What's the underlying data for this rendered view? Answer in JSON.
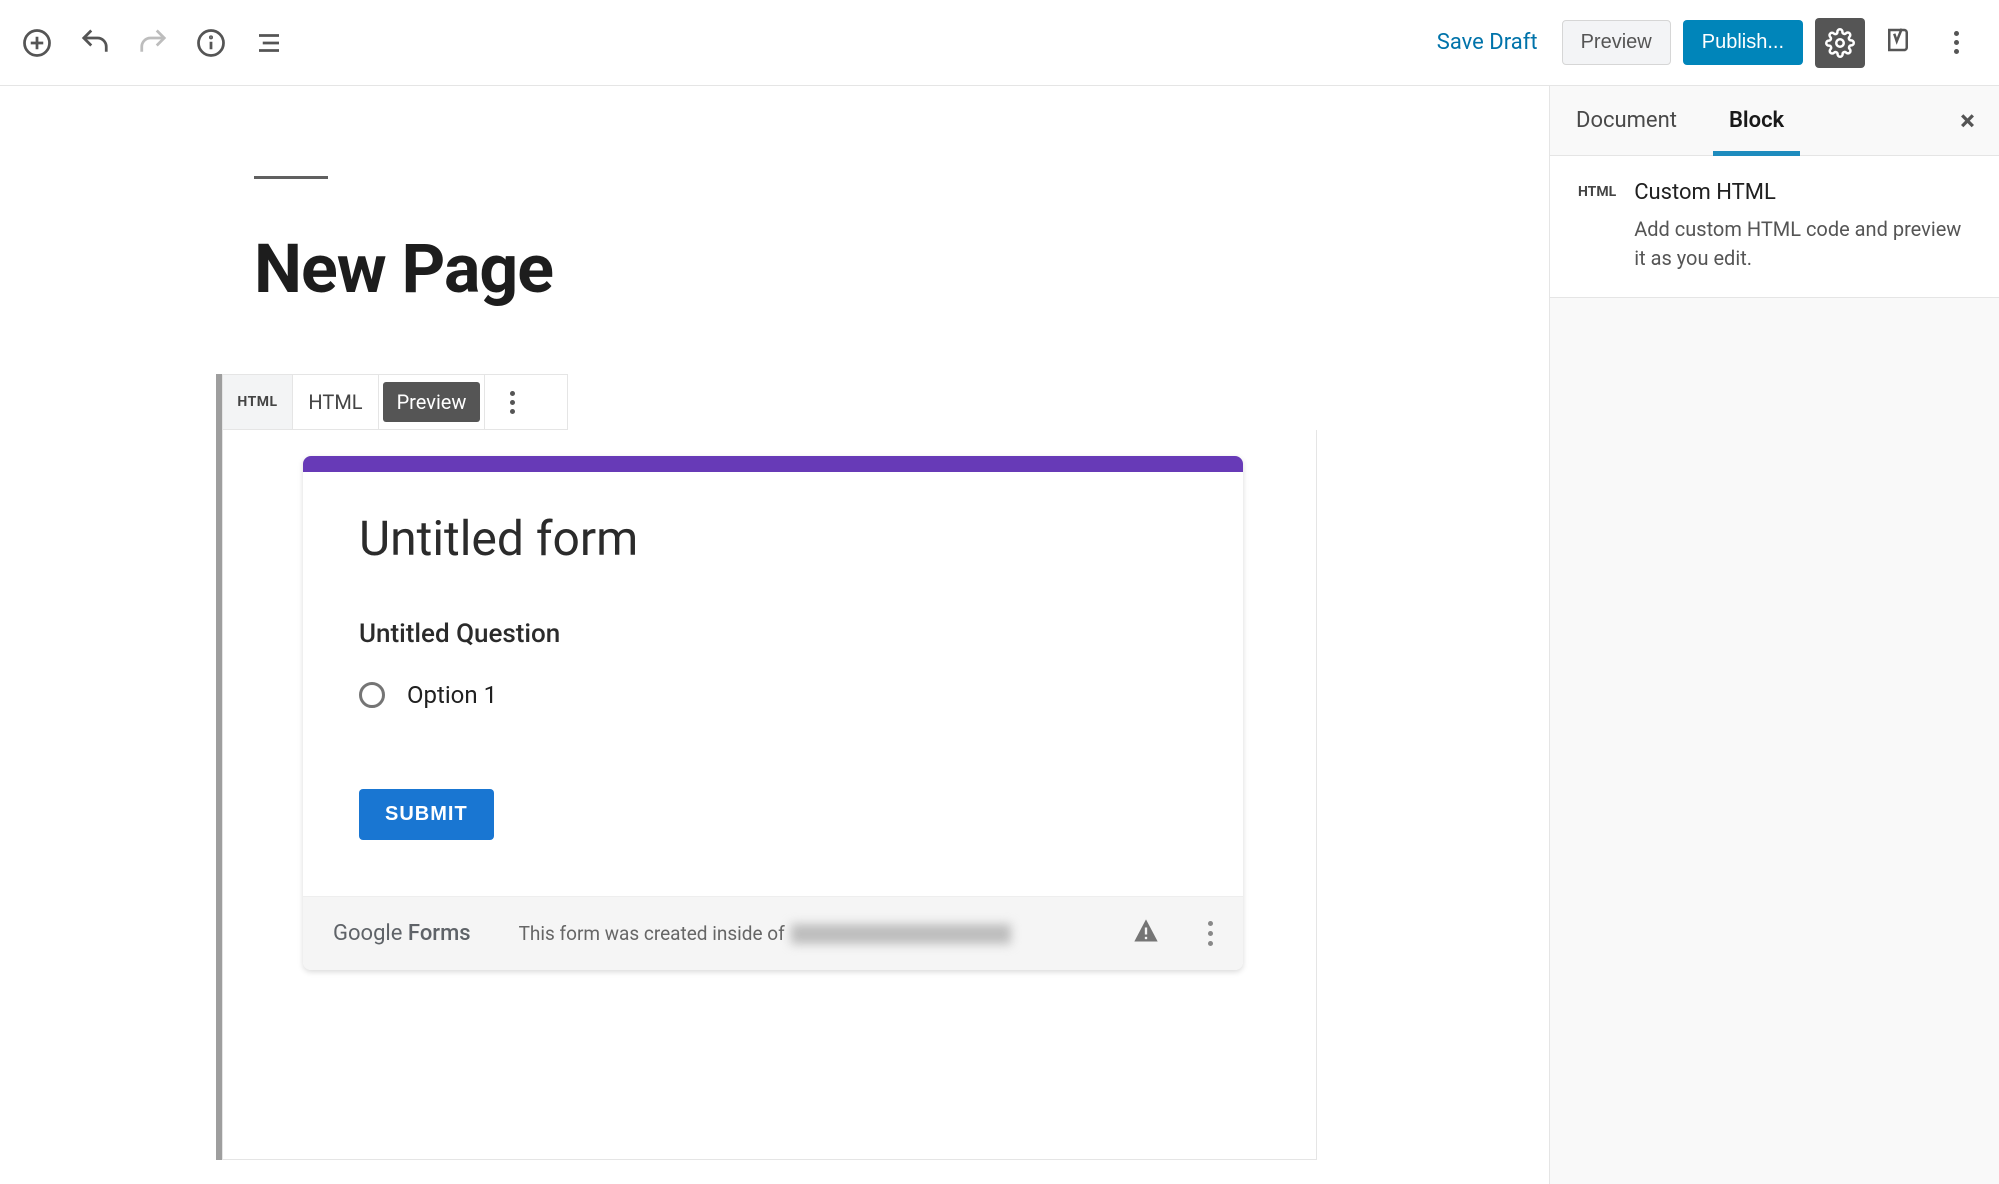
{
  "toolbar": {
    "save_draft": "Save Draft",
    "preview": "Preview",
    "publish": "Publish..."
  },
  "editor": {
    "page_title": "New Page"
  },
  "block_toolbar": {
    "icon_label": "HTML",
    "html_tab": "HTML",
    "preview_tab": "Preview"
  },
  "gform": {
    "title": "Untitled form",
    "question": "Untitled Question",
    "option1": "Option 1",
    "submit": "SUBMIT",
    "brand_google": "Google",
    "brand_forms": " Forms",
    "footer_text": "This form was created inside of "
  },
  "sidebar": {
    "tabs": {
      "document": "Document",
      "block": "Block"
    },
    "close": "×",
    "block_icon": "HTML",
    "block_title": "Custom HTML",
    "block_desc": "Add custom HTML code and preview it as you edit."
  }
}
